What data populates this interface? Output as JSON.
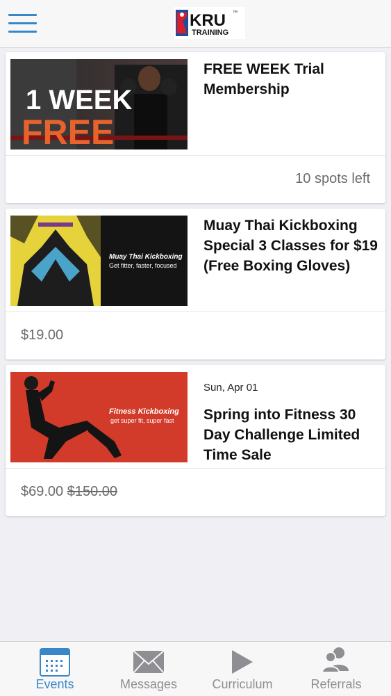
{
  "header": {
    "logo_text": "KRU",
    "logo_subtext": "TRAINING",
    "logo_tm": "™"
  },
  "events": [
    {
      "title": "FREE WEEK Trial Membership",
      "date": "",
      "image_text": [
        "1 WEEK",
        "FREE"
      ],
      "availability": "10 spots left",
      "price": "",
      "original_price": ""
    },
    {
      "title": "Muay Thai Kickboxing Special 3 Classes for $19 (Free Boxing Gloves)",
      "date": "",
      "image_text": [
        "Muay Thai Kickboxing",
        "Get fitter, faster, focused"
      ],
      "availability": "",
      "price": "$19.00",
      "original_price": ""
    },
    {
      "title": "Spring into Fitness 30 Day Challenge Limited Time Sale",
      "date": "Sun, Apr 01",
      "image_text": [
        "Fitness Kickboxing",
        "get super fit, super fast"
      ],
      "availability": "",
      "price": "$69.00",
      "original_price": "$150.00"
    }
  ],
  "tabbar": {
    "tabs": [
      {
        "label": "Events",
        "icon": "calendar-icon",
        "active": true
      },
      {
        "label": "Messages",
        "icon": "envelope-icon",
        "active": false
      },
      {
        "label": "Curriculum",
        "icon": "play-icon",
        "active": false
      },
      {
        "label": "Referrals",
        "icon": "people-icon",
        "active": false
      }
    ]
  },
  "colors": {
    "accent": "#3a87c8",
    "background": "#efeff4",
    "card": "#ffffff",
    "muted_text": "#6b6b6b",
    "tab_inactive": "#8e8e93",
    "brand_red": "#d81e2b",
    "brand_blue": "#1e4b9b"
  }
}
